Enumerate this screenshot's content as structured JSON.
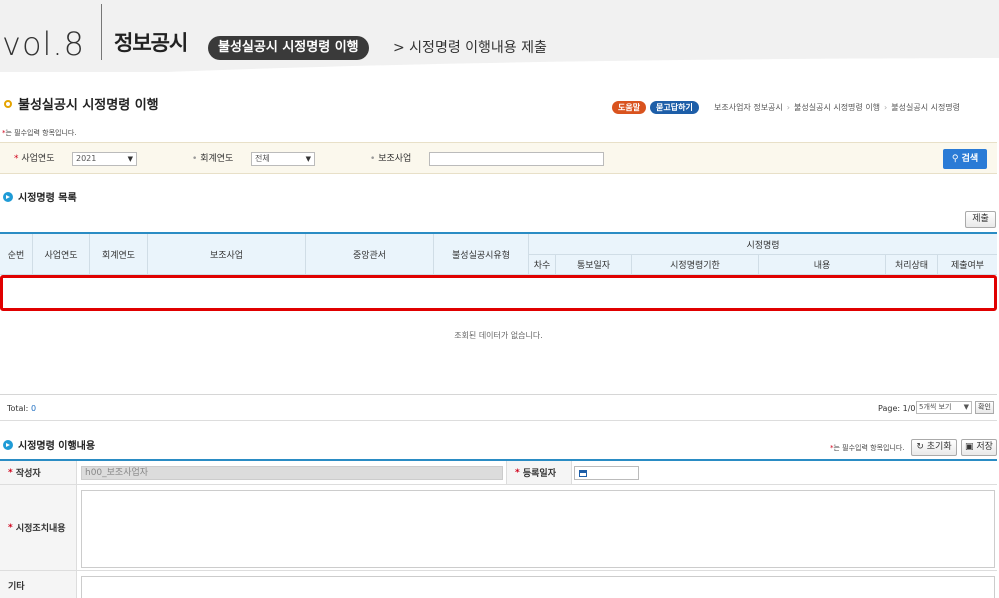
{
  "banner": {
    "vol": "vol.8",
    "brand": "정보공시",
    "topic": "불성실공시 시정명령 이행",
    "subtitle": "> 시정명령 이행내용 제출"
  },
  "page": {
    "title": "불성실공시 시정명령 이행",
    "help_label": "도움말",
    "qa_label": "묻고답하기",
    "breadcrumb": [
      "보조사업자 정보공시",
      "불성실공시 시정명령 이행",
      "불성실공시 시정명령"
    ],
    "required_note": "는 필수입력 항목입니다."
  },
  "search": {
    "year_label": "사업연도",
    "year_value": "2021",
    "fiscal_label": "회계연도",
    "fiscal_value": "전체",
    "project_label": "보조사업",
    "project_value": "",
    "search_label": "검색"
  },
  "list": {
    "title": "시정명령 목록",
    "submit_label": "제출",
    "columns": {
      "no": "순번",
      "year": "사업연도",
      "fiscal": "회계연도",
      "project": "보조사업",
      "ministry": "중앙관서",
      "type": "불성실공시유형",
      "group": "시정명령",
      "round": "차수",
      "notice_date": "통보일자",
      "deadline": "시정명령기한",
      "content": "내용",
      "status": "처리상태",
      "submitted": "제출여부"
    },
    "empty_message": "조회된 데이터가 없습니다.",
    "total_label": "Total:",
    "total_value": "0",
    "page_label": "Page: 1/0",
    "per_page": "5개씩 보기",
    "confirm_label": "확인"
  },
  "form": {
    "title": "시정명령 이행내용",
    "required_note": "는 필수입력 항목입니다.",
    "reset_label": "초기화",
    "save_label": "저장",
    "author_label": "작성자",
    "author_value": "h00_보조사업자",
    "reg_date_label": "등록일자",
    "reg_date_value": "",
    "action_label": "시정조치내용",
    "etc_label": "기타"
  },
  "colors": {
    "accent_blue": "#2a8cc4",
    "search_btn": "#2a7bd6",
    "help_btn": "#d9531e",
    "qa_btn": "#1d5ea8",
    "highlight": "#e00000",
    "required": "#d0021b"
  },
  "icons": {
    "title_ring": "ring-icon",
    "section": "arrow-circle-icon",
    "search": "magnifier-icon",
    "reset": "refresh-icon",
    "save": "floppy-icon",
    "calendar": "calendar-icon"
  }
}
